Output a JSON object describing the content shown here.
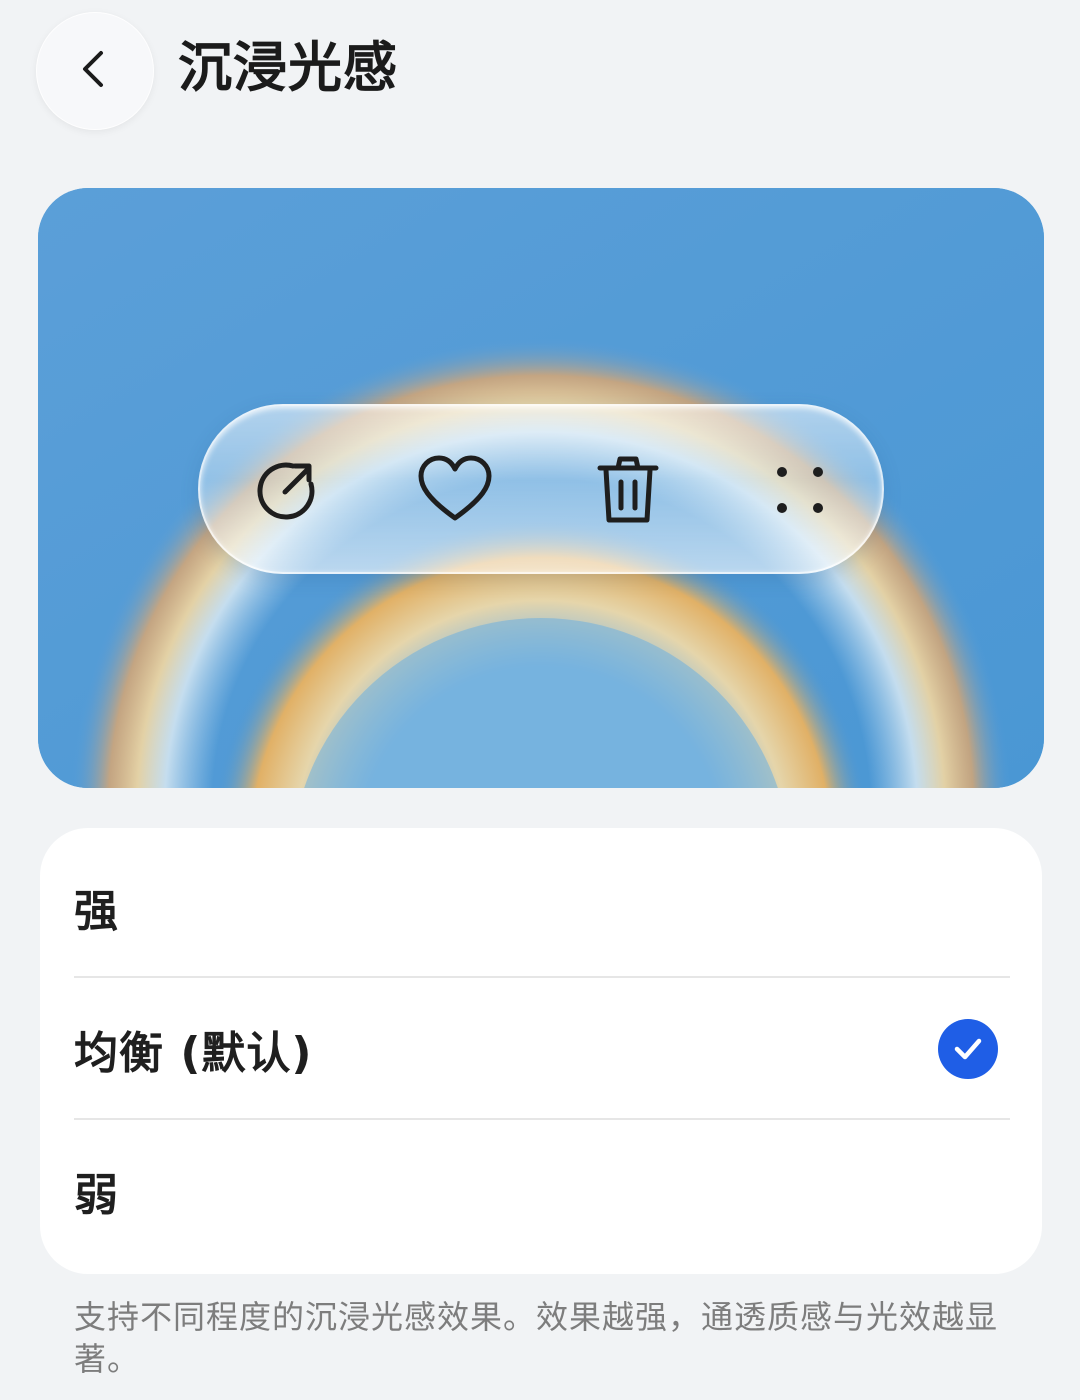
{
  "header": {
    "title": "沉浸光感",
    "back_icon": "chevron-left-icon"
  },
  "preview": {
    "toolbar_icons": [
      "share-icon",
      "heart-icon",
      "trash-icon",
      "more-dots-icon"
    ]
  },
  "options": [
    {
      "label": "强",
      "selected": false
    },
    {
      "label": "均衡 (默认)",
      "selected": true
    },
    {
      "label": "弱",
      "selected": false
    }
  ],
  "description": "支持不同程度的沉浸光感效果。效果越强，通透质感与光效越显著。",
  "colors": {
    "accent": "#1f5ee6",
    "background": "#f1f3f5",
    "preview_blue": "#5a9ed6"
  }
}
